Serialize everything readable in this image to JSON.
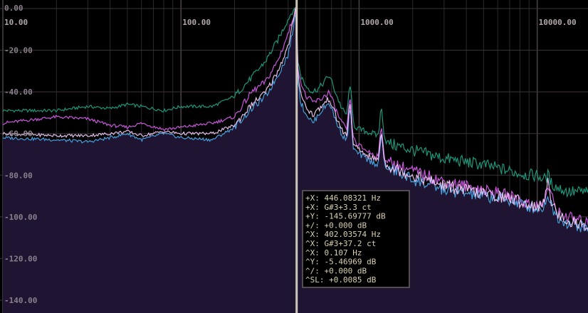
{
  "chart_data": {
    "type": "line",
    "x_scale": "log",
    "xlim": [
      10,
      20000
    ],
    "ylim": [
      -140,
      0
    ],
    "grid": true,
    "x_ticks": [
      {
        "value": 10,
        "label": "10.00"
      },
      {
        "value": 100,
        "label": "100.00"
      },
      {
        "value": 1000,
        "label": "1000.00"
      },
      {
        "value": 10000,
        "label": "10000.00"
      }
    ],
    "y_ticks": [
      {
        "value": 0,
        "label": "0.00"
      },
      {
        "value": -20,
        "label": "-20.00"
      },
      {
        "value": -40,
        "label": "-40.00"
      },
      {
        "value": -60,
        "label": "-60.00"
      },
      {
        "value": -80,
        "label": "-80.00"
      },
      {
        "value": -100,
        "label": "-100.00"
      },
      {
        "value": -120,
        "label": "-120.00"
      },
      {
        "value": -140,
        "label": "-140.00"
      }
    ],
    "marker_frequencies": [
      443,
      449
    ],
    "series": [
      {
        "color": "#1e9e80",
        "x": [
          10,
          20,
          30,
          40,
          50,
          60,
          80,
          100,
          150,
          200,
          250,
          300,
          350,
          400,
          430,
          440,
          446,
          452,
          470,
          500,
          550,
          600,
          680,
          750,
          800,
          900,
          1000,
          1200,
          1500,
          2000,
          3000,
          5000,
          7000,
          9000,
          10000,
          11000,
          11500,
          12000,
          13000,
          15000,
          20000
        ],
        "y": [
          -49,
          -49,
          -47,
          -48,
          -46,
          -47,
          -49,
          -47,
          -47,
          -42,
          -33,
          -25,
          -15,
          -5,
          0,
          -3,
          -7,
          -25,
          -32,
          -37,
          -40,
          -38,
          -32,
          -42,
          -48,
          -55,
          -58,
          -60,
          -65,
          -68,
          -72,
          -75,
          -78,
          -80,
          -80,
          -82,
          -80,
          -84,
          -86,
          -88,
          -88
        ]
      },
      {
        "color": "#d45ce8",
        "x": [
          10,
          20,
          30,
          40,
          50,
          60,
          80,
          100,
          150,
          200,
          250,
          300,
          350,
          400,
          430,
          440,
          446,
          452,
          470,
          500,
          550,
          600,
          680,
          750,
          800,
          900,
          1000,
          1200,
          1500,
          2000,
          3000,
          5000,
          7000,
          9000,
          10000,
          11000,
          11500,
          12000,
          13000,
          15000,
          20000
        ],
        "y": [
          -55,
          -52,
          -53,
          -56,
          -57,
          -55,
          -58,
          -57,
          -55,
          -52,
          -40,
          -35,
          -25,
          -12,
          -3,
          -1,
          -5,
          -27,
          -35,
          -42,
          -45,
          -44,
          -40,
          -50,
          -55,
          -62,
          -66,
          -70,
          -74,
          -78,
          -83,
          -87,
          -90,
          -94,
          -95,
          -93,
          -85,
          -90,
          -98,
          -100,
          -104
        ]
      },
      {
        "color": "#4aa8e8",
        "x": [
          10,
          20,
          30,
          40,
          50,
          60,
          80,
          100,
          150,
          200,
          250,
          300,
          350,
          400,
          430,
          440,
          446,
          452,
          470,
          500,
          550,
          600,
          680,
          750,
          800,
          900,
          1000,
          1200,
          1500,
          2000,
          3000,
          5000,
          7000,
          9000,
          10000,
          11000,
          11500,
          12000,
          13000,
          15000,
          20000
        ],
        "y": [
          -62,
          -63,
          -64,
          -62,
          -60,
          -63,
          -60,
          -62,
          -63,
          -57,
          -48,
          -42,
          -32,
          -22,
          -8,
          -1,
          -8,
          -33,
          -45,
          -50,
          -55,
          -50,
          -45,
          -55,
          -60,
          -67,
          -70,
          -74,
          -77,
          -82,
          -87,
          -90,
          -92,
          -95,
          -96,
          -95,
          -88,
          -95,
          -100,
          -103,
          -106
        ]
      },
      {
        "color": "#f0c8f5",
        "x": [
          10,
          20,
          30,
          40,
          50,
          60,
          80,
          100,
          150,
          200,
          250,
          300,
          350,
          400,
          430,
          440,
          446,
          452,
          470,
          500,
          550,
          600,
          680,
          750,
          800,
          900,
          1000,
          1200,
          1500,
          2000,
          3000,
          5000,
          7000,
          9000,
          10000,
          11000,
          11500,
          12000,
          13000,
          15000,
          20000
        ],
        "y": [
          -60,
          -61,
          -61,
          -60,
          -59,
          -61,
          -59,
          -60,
          -60,
          -56,
          -46,
          -40,
          -30,
          -18,
          -5,
          0,
          -6,
          -30,
          -40,
          -47,
          -51,
          -48,
          -43,
          -53,
          -58,
          -65,
          -68,
          -72,
          -76,
          -80,
          -85,
          -89,
          -91,
          -94,
          -95,
          -94,
          -80,
          -92,
          -99,
          -102,
          -105
        ]
      }
    ],
    "fill_color": "#1f1533",
    "readout": {
      "lines": [
        "+X:    446.08321 Hz",
        "+X:   G#3+3.3 ct",
        "+Y:   -145.69777 dB",
        "+/:    +0.000 dB",
        "^X:    402.03574 Hz",
        "^X:  G#3+37.2 ct",
        "^X:    0.107 Hz",
        "^Y:   -5.46969 dB",
        "^/:   +0.000 dB",
        "^SL: +0.0085 dB"
      ]
    }
  }
}
